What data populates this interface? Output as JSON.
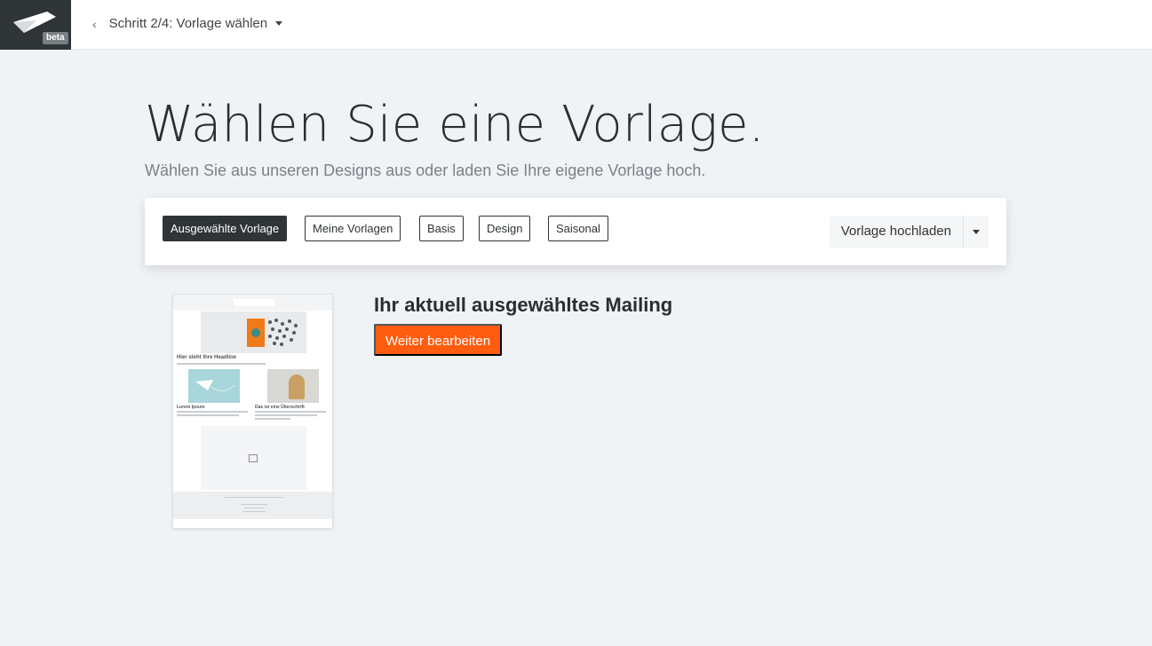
{
  "header": {
    "logo_icon": "envelope-logo-icon",
    "beta_label": "beta",
    "back_icon": "chevron-left-icon",
    "back_glyph": "‹",
    "step_label": "Schritt 2/4: Vorlage wählen",
    "step_caret_icon": "caret-down-icon"
  },
  "main": {
    "title": "Wählen Sie eine Vorlage.",
    "subtitle": "Wählen Sie aus unseren Designs aus oder laden Sie Ihre eigene Vorlage hoch."
  },
  "filters": {
    "chips": [
      {
        "label": "Ausgewählte Vorlage",
        "active": true
      },
      {
        "label": "Meine Vorlagen",
        "active": false
      },
      {
        "label": "Basis",
        "active": false
      },
      {
        "label": "Design",
        "active": false
      },
      {
        "label": "Saisonal",
        "active": false
      }
    ],
    "upload_label": "Vorlage hochladen",
    "upload_dropdown_icon": "caret-down-icon"
  },
  "selected": {
    "heading": "Ihr aktuell ausgewähltes Mailing",
    "button_label": "Weiter bearbeiten",
    "thumbnail": {
      "headline": "Hier steht Ihre Headline",
      "col1_title": "Lorem Ipsum",
      "col2_title": "Das ist eine Überschrift"
    }
  },
  "colors": {
    "accent": "#ff5c0f",
    "dark": "#2f3437",
    "background": "#f0f3f6"
  }
}
